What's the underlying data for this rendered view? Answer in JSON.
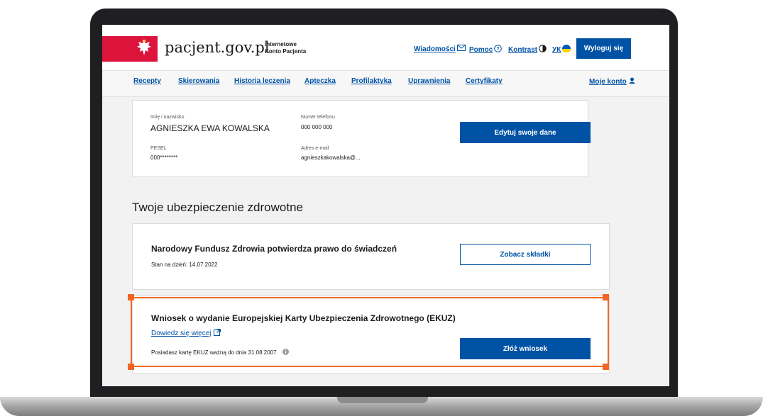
{
  "header": {
    "logo_text": "pacjent.gov.pl",
    "logo_sub_line1": "Internetowe",
    "logo_sub_line2": "Konto Pacjenta",
    "links": [
      {
        "label": "Wiadomości",
        "icon": "envelope-icon"
      },
      {
        "label": "Pomoc",
        "icon": "help-circle-icon"
      },
      {
        "label": "Kontrast",
        "icon": "contrast-icon"
      },
      {
        "label": "УК",
        "icon": "ukraine-flag-icon"
      }
    ],
    "logout_label": "Wyloguj się"
  },
  "nav": {
    "items": [
      "Recepty",
      "Skierowania",
      "Historia leczenia",
      "Apteczka",
      "Profilaktyka",
      "Uprawnienia",
      "Certyfikaty"
    ],
    "account_label": "Moje konto",
    "account_icon": "user-icon"
  },
  "profile": {
    "name_label": "Imię i nazwisko",
    "name_value": "AGNIESZKA EWA KOWALSKA",
    "phone_label": "Numer telefonu",
    "phone_value": "000 000 000",
    "pesel_label": "PESEL",
    "pesel_value": "000********",
    "email_label": "Adres e-mail",
    "email_value": "agnieszkakowalska@...",
    "edit_button": "Edytuj swoje dane"
  },
  "insurance": {
    "section_title": "Twoje ubezpieczenie zdrowotne",
    "nfz_title": "Narodowy Fundusz Zdrowia potwierdza prawo do świadczeń",
    "nfz_status": "Stan na dzień: 14.07.2022",
    "nfz_button": "Zobacz składki",
    "ekuz_title": "Wniosek o wydanie Europejskiej Karty Ubezpieczenia Zdrowotnego (EKUZ)",
    "ekuz_link": "Dowiedz się więcej",
    "ekuz_info": "Posiadasz kartę EKUZ ważną do dnia 31.08.2007",
    "ekuz_button": "Złóż wniosek"
  },
  "colors": {
    "brand_blue": "#0052a5",
    "flag_red": "#dc143c",
    "highlight_orange": "#f26522"
  }
}
